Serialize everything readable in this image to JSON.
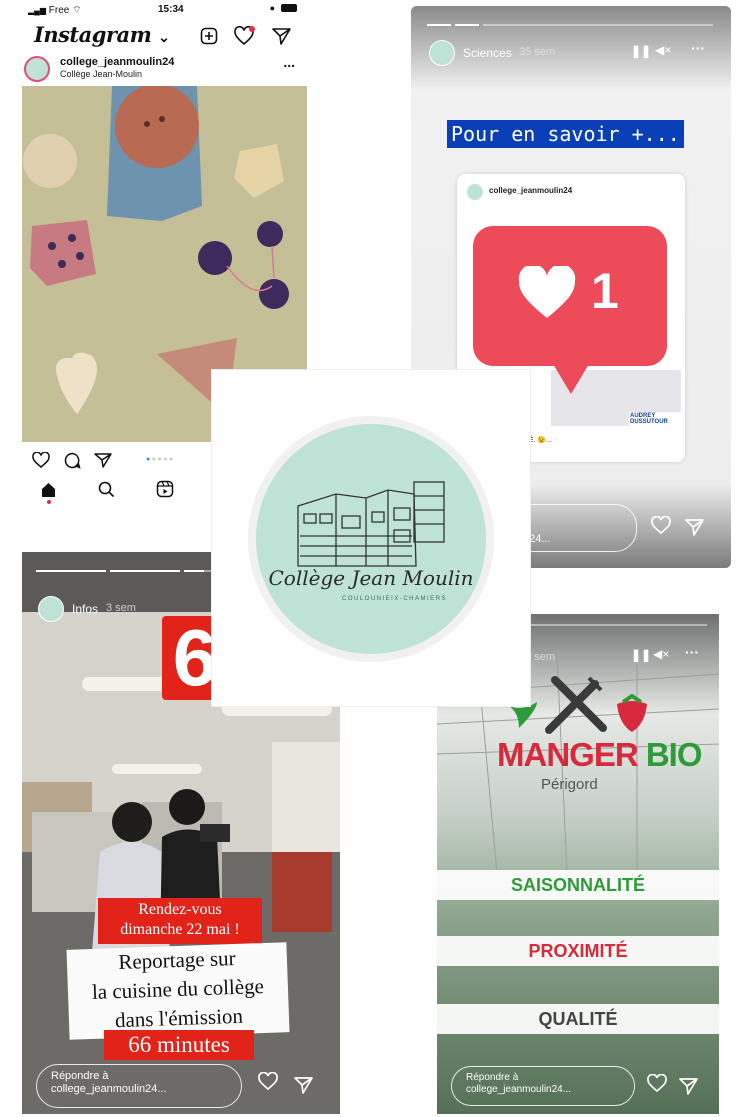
{
  "feed": {
    "status": {
      "carrier": "Free",
      "time": "15:34"
    },
    "app_title": "Instagram",
    "title_chevron": "⌄",
    "post": {
      "username": "college_jeanmoulin24",
      "subtitle": "Collège Jean-Moulin",
      "more": "..."
    }
  },
  "story_sciences": {
    "user": "Sciences",
    "time": "35 sem",
    "headline": "Pour en savoir +...",
    "embedded_user": "college_jeanmoulin24",
    "like_count": "1",
    "credit": "AUDREY DUSSUTOUR",
    "caption_user": "ulin24",
    "caption_text": "LE BLOB EST ARRIVÉ. 😉...",
    "reply_text": "ulin24..."
  },
  "logo": {
    "name": "Collège Jean Moulin",
    "subline": "COULOUNIEIX-CHAMIERS"
  },
  "story_infos": {
    "user": "Infos",
    "time": "3 sem",
    "channel": "6",
    "line1": "Rendez-vous",
    "line2": "dimanche 22 mai !",
    "line3": "Reportage sur",
    "line4": "la cuisine du collège",
    "line5": "dans l'émission",
    "line6": "66 minutes",
    "reply_label": "Répondre à",
    "reply_user": "college_jeanmoulin24..."
  },
  "story_bio": {
    "user": "O",
    "time": "31 sem",
    "title1": "MANGER",
    "title2": "BIO",
    "subtitle": "Périgord",
    "item1": "SAISONNALITÉ",
    "item2": "PROXIMITÉ",
    "item3": "QUALITÉ",
    "reply_label": "Répondre à",
    "reply_user": "college_jeanmoulin24..."
  },
  "colors": {
    "ig_red": "#ed4a5a",
    "bio_red": "#d72a3c",
    "bio_green": "#2f9a3a",
    "m6_red": "#e2231a",
    "highlight_blue": "#0a3fb8"
  }
}
